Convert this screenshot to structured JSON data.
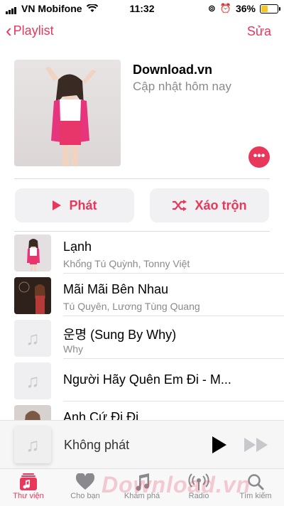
{
  "status": {
    "carrier": "VN Mobifone",
    "time": "11:32",
    "battery": "36%",
    "battery_level": 0.36
  },
  "nav": {
    "back_label": "Playlist",
    "edit_label": "Sửa"
  },
  "playlist": {
    "title": "Download.vn",
    "subtitle": "Cập nhật hôm nay"
  },
  "actions": {
    "play_label": "Phát",
    "shuffle_label": "Xáo trộn"
  },
  "songs": [
    {
      "title": "Lạnh",
      "artist": "Khổng Tú Quỳnh, Tonny Việt",
      "art": "photo-pink"
    },
    {
      "title": "Mãi Mãi Bên Nhau",
      "artist": "Tú Quyên, Lương Tùng Quang",
      "art": "photo-dark"
    },
    {
      "title": "운명 (Sung By Why)",
      "artist": "Why",
      "art": "placeholder-note"
    },
    {
      "title": "Người Hãy Quên Em Đi - M...",
      "artist": "",
      "art": "placeholder-note"
    },
    {
      "title": "Anh Cứ Đi Đi",
      "artist": "",
      "art": "photo-light"
    }
  ],
  "mini_player": {
    "label": "Không phát"
  },
  "tabs": [
    {
      "label": "Thư viện",
      "icon": "library-icon",
      "active": true
    },
    {
      "label": "Cho bạn",
      "icon": "heart-icon",
      "active": false
    },
    {
      "label": "Khám phá",
      "icon": "music-note-icon",
      "active": false
    },
    {
      "label": "Radio",
      "icon": "radio-icon",
      "active": false
    },
    {
      "label": "Tìm kiếm",
      "icon": "search-icon",
      "active": false
    }
  ],
  "watermark": "Download.vn",
  "colors": {
    "accent": "#e8375a"
  }
}
